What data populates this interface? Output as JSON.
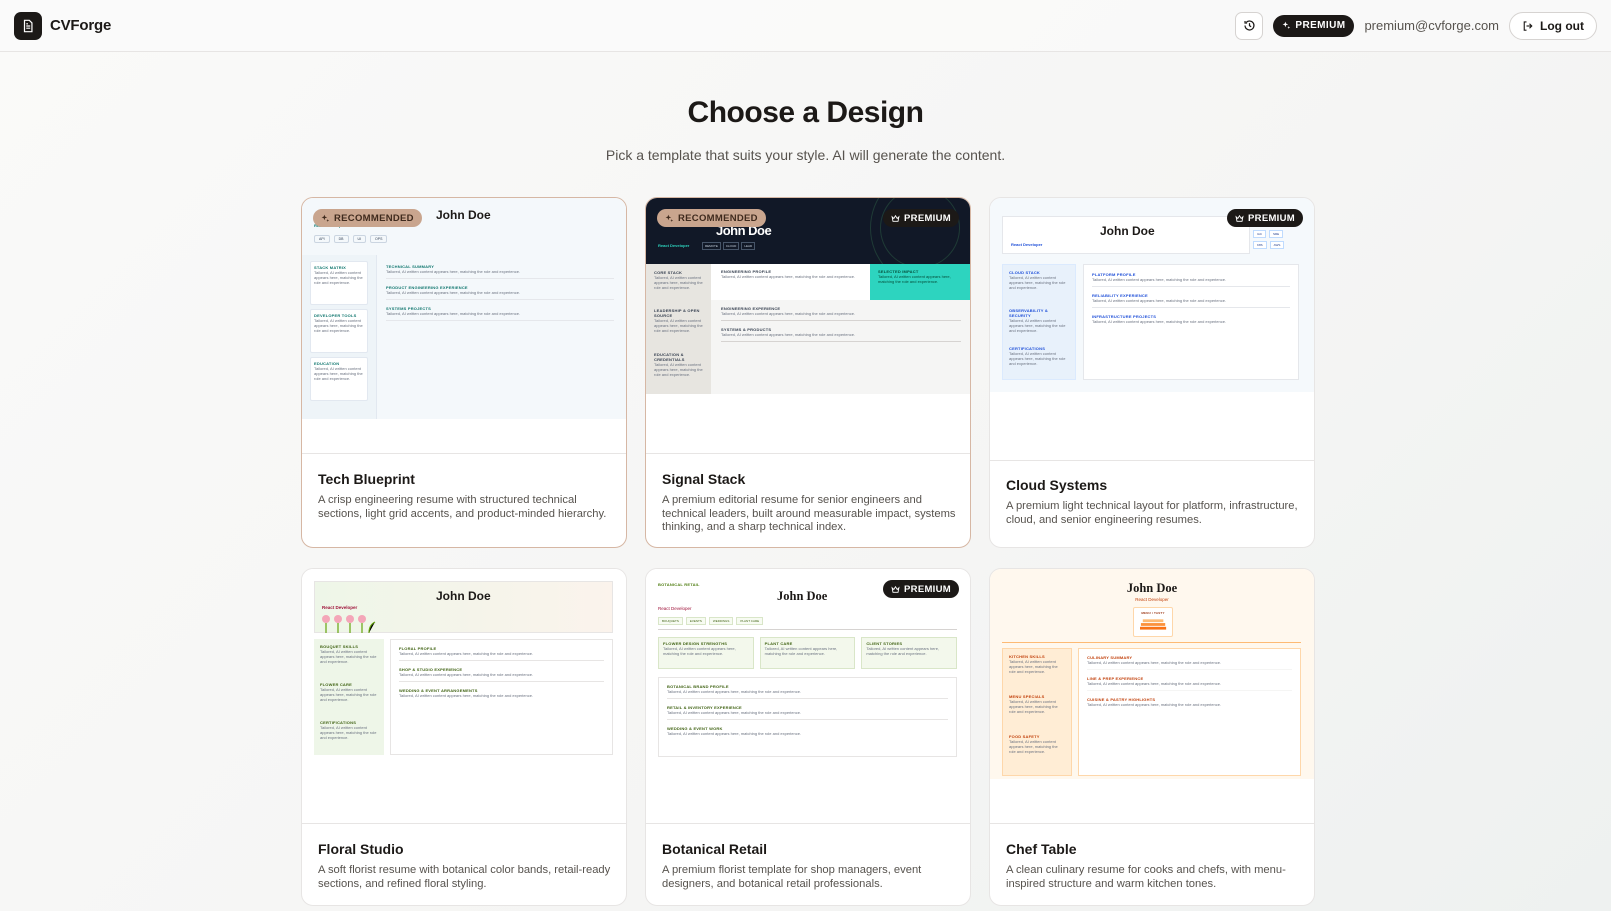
{
  "header": {
    "brand": "CVForge",
    "premium_label": "PREMIUM",
    "email": "premium@cvforge.com",
    "logout_label": "Log out"
  },
  "page": {
    "title": "Choose a Design",
    "subtitle": "Pick a template that suits your style. AI will generate the content."
  },
  "labels": {
    "recommended": "RECOMMENDED",
    "premium": "PREMIUM"
  },
  "sample": {
    "name": "John Doe",
    "role": "React Developer",
    "filler": "Tailored, AI written content appears here, matching the role and experience.",
    "filler_short": "Tailored, AI written content appears here, matching the role and experience."
  },
  "templates": [
    {
      "name": "Tech Blueprint",
      "description": "A crisp engineering resume with structured technical sections, light grid accents, and product-minded hierarchy.",
      "sections_left": [
        "STACK MATRIX",
        "DEVELOPER TOOLS",
        "EDUCATION"
      ],
      "sections_right": [
        "TECHNICAL SUMMARY",
        "PRODUCT ENGINEERING EXPERIENCE",
        "SYSTEMS PROJECTS"
      ],
      "chips": [
        "API",
        "DB",
        "UI",
        "OPS"
      ]
    },
    {
      "name": "Signal Stack",
      "description": "A premium editorial resume for senior engineers and technical leaders, built around measurable impact, systems thinking, and a sharp technical index.",
      "sections_left": [
        "CORE STACK",
        "LEADERSHIP & OPEN SOURCE",
        "EDUCATION & CREDENTIALS"
      ],
      "sections_right": [
        "ENGINEERING PROFILE",
        "ENGINEERING EXPERIENCE",
        "SYSTEMS & PRODUCTS"
      ],
      "highlight": "SELECTED IMPACT",
      "chips": [
        "REMOTE",
        "CLOUD",
        "LEAD"
      ]
    },
    {
      "name": "Cloud Systems",
      "description": "A premium light technical layout for platform, infrastructure, cloud, and senior engineering resumes.",
      "sections_left": [
        "CLOUD STACK",
        "OBSERVABILITY & SECURITY",
        "CERTIFICATIONS"
      ],
      "sections_right": [
        "PLATFORM PROFILE",
        "RELIABILITY EXPERIENCE",
        "INFRASTRUCTURE PROJECTS"
      ],
      "chips": [
        "IAC",
        "SRE",
        "K8S",
        "AWS"
      ]
    },
    {
      "name": "Floral Studio",
      "description": "A soft florist resume with botanical color bands, retail-ready sections, and refined floral styling.",
      "sections_left": [
        "BOUQUET SKILLS",
        "FLOWER CARE",
        "CERTIFICATIONS"
      ],
      "sections_right": [
        "FLORAL PROFILE",
        "SHOP & STUDIO EXPERIENCE",
        "WEDDING & EVENT ARRANGEMENTS"
      ]
    },
    {
      "name": "Botanical Retail",
      "description": "A premium florist template for shop managers, event designers, and botanical retail professionals.",
      "top_label": "BOTANICAL RETAIL",
      "chips": [
        "BOUQUETS",
        "EVENTS",
        "WEDDINGS",
        "PLANT CARE"
      ],
      "sections_top": [
        "FLOWER DESIGN STRENGTHS",
        "PLANT CARE",
        "CLIENT STORIES"
      ],
      "sections_main": [
        "BOTANICAL BRAND PROFILE",
        "RETAIL & INVENTORY EXPERIENCE",
        "WEDDING & EVENT WORK"
      ]
    },
    {
      "name": "Chef Table",
      "description": "A clean culinary resume for cooks and chefs, with menu-inspired structure and warm kitchen tones.",
      "menu_label": "MENU / TASTY",
      "sections_left": [
        "KITCHEN SKILLS",
        "MENU SPECIALS",
        "FOOD SAFETY"
      ],
      "sections_right": [
        "CULINARY SUMMARY",
        "LINE & PREP EXPERIENCE",
        "CUISINE & PASTRY HIGHLIGHTS"
      ]
    }
  ]
}
